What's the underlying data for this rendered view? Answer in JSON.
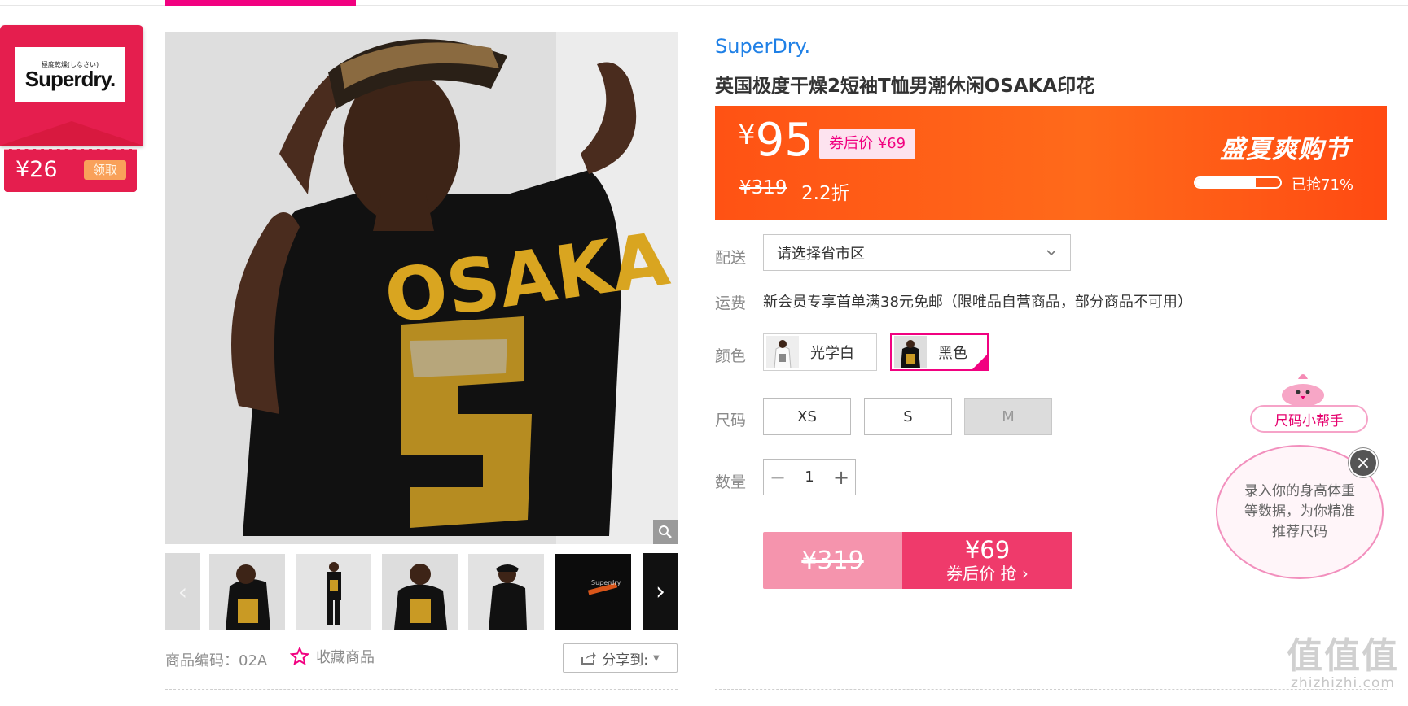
{
  "coupon": {
    "logo_small": "極度乾燥(しなさい)",
    "logo_big": "Superdry.",
    "value": "¥26",
    "claim_label": "领取"
  },
  "product": {
    "brand": "SuperDry.",
    "title": "英国极度干燥2短袖T恤男潮休闲OSAKA印花",
    "price_symbol": "¥",
    "price": "95",
    "coupon_price": "券后价 ¥69",
    "original_price": "¥319",
    "discount": "2.2折",
    "festival": "盛夏爽购节",
    "sold_progress": 0.71,
    "sold_label": "已抢71%",
    "sku_text": "商品编码：02A",
    "favorite_label": "收藏商品",
    "share_label": "分享到:"
  },
  "shipping": {
    "label": "配送",
    "placeholder": "请选择省市区"
  },
  "fee": {
    "label": "运费",
    "text": "新会员专享首单满38元免邮（限唯品自营商品，部分商品不可用）"
  },
  "colors": {
    "label": "颜色",
    "options": [
      {
        "name": "光学白",
        "selected": false
      },
      {
        "name": "黑色",
        "selected": true
      }
    ]
  },
  "sizes": {
    "label": "尺码",
    "options": [
      {
        "name": "XS",
        "available": true
      },
      {
        "name": "S",
        "available": true
      },
      {
        "name": "M",
        "available": false
      }
    ]
  },
  "quantity": {
    "label": "数量",
    "minus": "−",
    "value": "1",
    "plus": "+"
  },
  "buy": {
    "original": "¥319",
    "price": "¥69",
    "cta": "券后价 抢 ›"
  },
  "size_helper": {
    "title": "尺码小帮手",
    "text": "录入你的身高体重等数据，为你精准推荐尺码",
    "close": "×"
  },
  "watermark": {
    "big": "值值值",
    "small": "zhizhizhi.com"
  },
  "colors_theme": {
    "accent": "#f10180",
    "price_bar": "#ff5214",
    "brand_link": "#1f80e6",
    "coupon_red": "#e51e4e"
  }
}
